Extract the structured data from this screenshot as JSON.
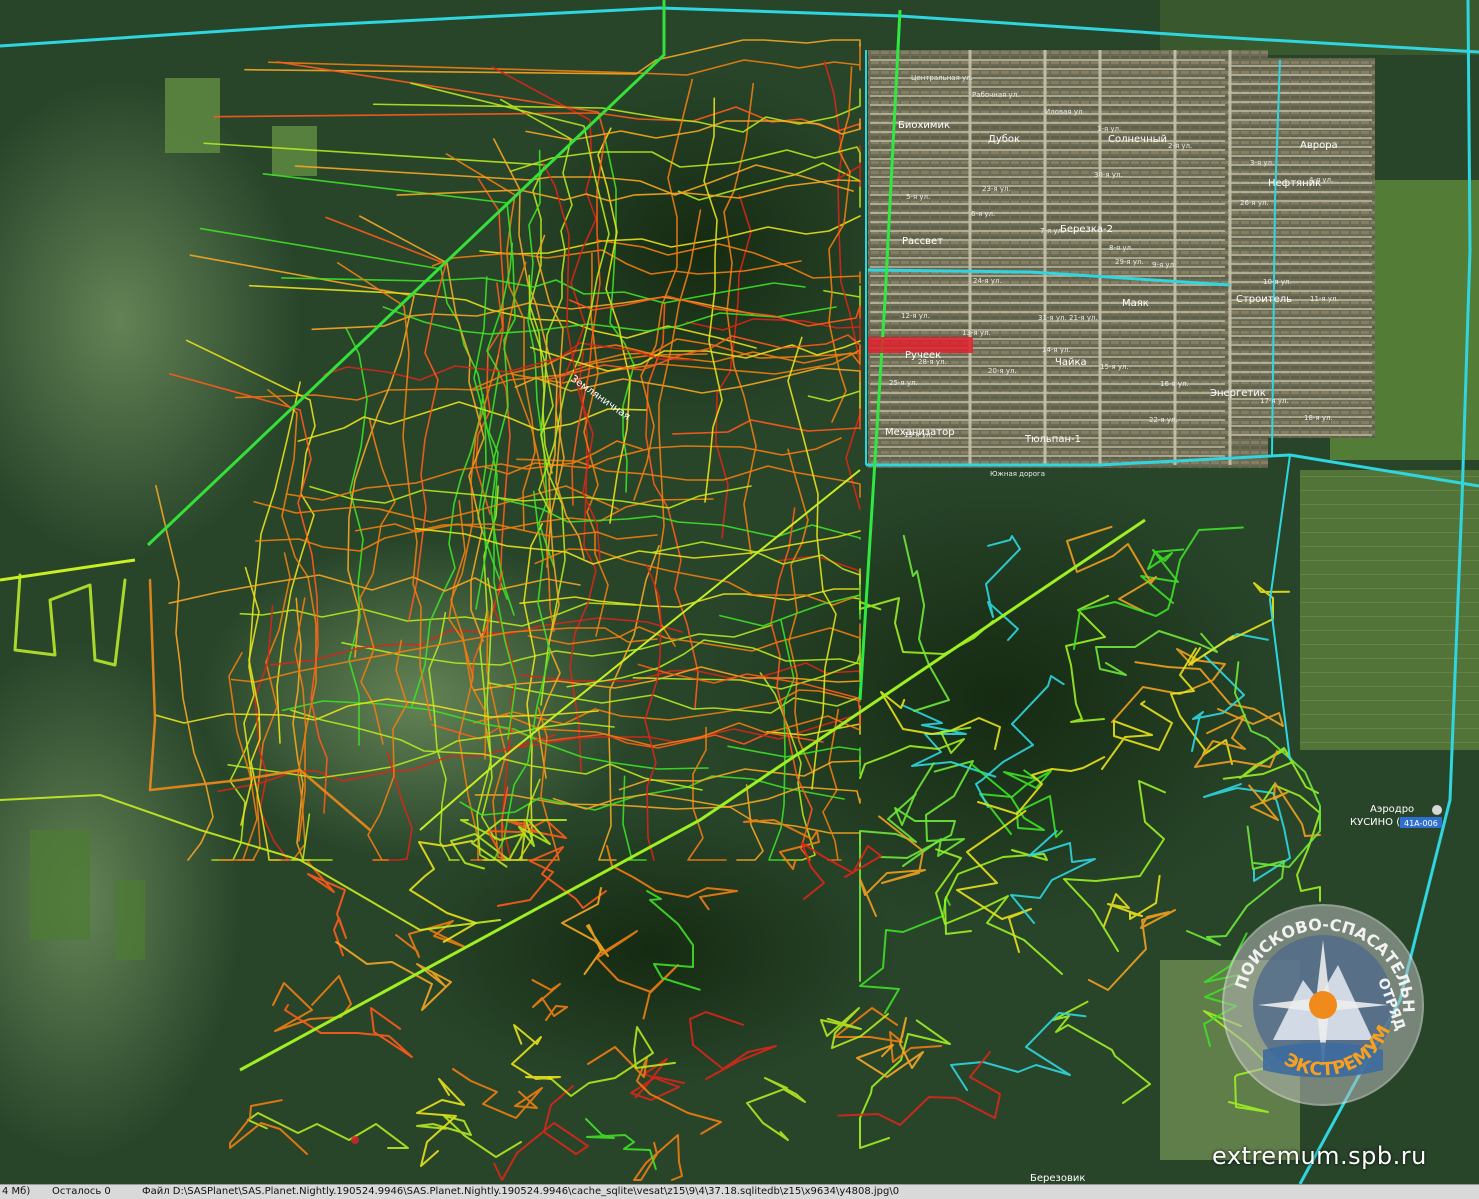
{
  "map": {
    "colors": {
      "forest_dark": "#1b3619",
      "forest": "#2c4a24",
      "field": "#5d7a3d",
      "settlement": "#7a7860",
      "road_cyan": "#2fd6e0",
      "track_red": "#d8261a",
      "track_orange": "#f07d12",
      "track_yellow": "#e8e21c",
      "track_green": "#3fe028"
    },
    "settlement_labels": [
      "Биохимик",
      "Дубок",
      "Солнечный",
      "Аврора",
      "Рассвет",
      "Березка-2",
      "Нефтяник",
      "Маяк",
      "Строитель",
      "Ручеек",
      "Чайка",
      "Энергетик",
      "Механизатор",
      "Тюльпан-1"
    ],
    "small_labels": [
      "Южная дорога",
      "Центральная ул.",
      "Рабочная ул.",
      "Иловая ул.",
      "1-я ул.",
      "2-я ул.",
      "3-я ул.",
      "4-я ул.",
      "5-я ул.",
      "6-я ул.",
      "7-я ул.",
      "8-я ул.",
      "9-я ул.",
      "10-я ул.",
      "11-я ул.",
      "12-я ул.",
      "13-я ул.",
      "14-я ул.",
      "15-я ул.",
      "16-я ул.",
      "17-я ул.",
      "18-я ул.",
      "19-я ул.",
      "20-я ул.",
      "21-я ул.",
      "22-я ул.",
      "23-я ул.",
      "24-я ул.",
      "25-я ул.",
      "26-я ул.",
      "28-я ул.",
      "29-я ул.",
      "30-я ул.",
      "31-я ул."
    ],
    "road_label": "Земляничная",
    "airport_label_1": "Аэродро",
    "airport_label_2": "КУСИНО (У",
    "road_badge": "41А-006",
    "bottom_label": "Березовик",
    "logo": {
      "top_text": "ПОИСКОВО-СПАСАТЕЛЬНЫЙ",
      "right_text": "ОТРЯД",
      "bottom_text": "ЭКСТРЕМУМ"
    },
    "watermark": "extremum.spb.ru"
  },
  "statusbar": {
    "size": "4 Мб)",
    "remaining": "Осталось 0",
    "file": "Файл D:\\SASPlanet\\SAS.Planet.Nightly.190524.9946\\SAS.Planet.Nightly.190524.9946\\cache_sqlite\\vesat\\z15\\9\\4\\37.18.sqlitedb\\z15\\x9634\\y4808.jpg\\0"
  }
}
